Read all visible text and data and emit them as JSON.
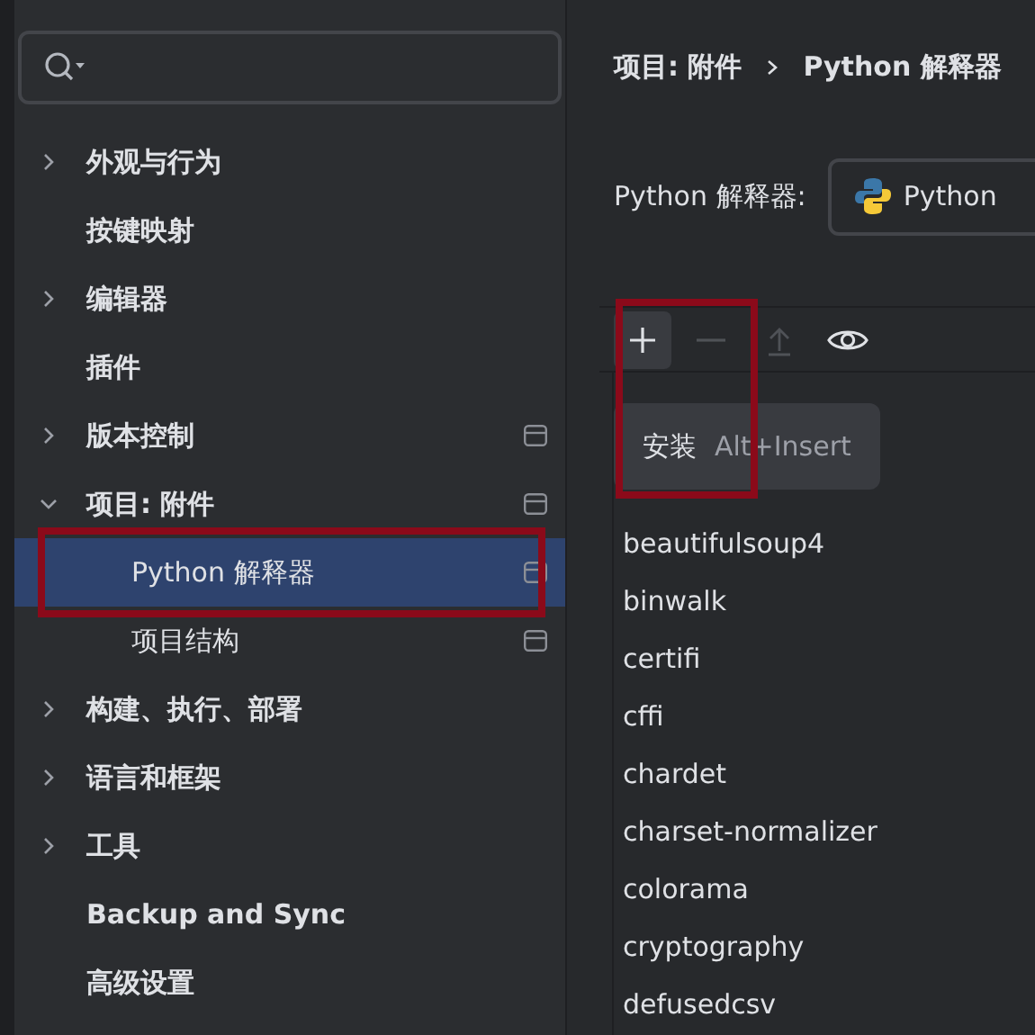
{
  "sidebar": {
    "items": [
      {
        "label": "外观与行为",
        "expanded": false,
        "selected": false,
        "scoped": false
      },
      {
        "label": "按键映射",
        "selected": false,
        "scoped": false
      },
      {
        "label": "编辑器",
        "expanded": false,
        "selected": false,
        "scoped": false
      },
      {
        "label": "插件",
        "selected": false,
        "scoped": false
      },
      {
        "label": "版本控制",
        "expanded": false,
        "selected": false,
        "scoped": true
      },
      {
        "label": "项目: 附件",
        "expanded": true,
        "selected": false,
        "scoped": true,
        "children": [
          {
            "label": "Python 解释器",
            "selected": true,
            "scoped": true
          },
          {
            "label": "项目结构",
            "selected": false,
            "scoped": true
          }
        ]
      },
      {
        "label": "构建、执行、部署",
        "expanded": false,
        "selected": false,
        "scoped": false
      },
      {
        "label": "语言和框架",
        "expanded": false,
        "selected": false,
        "scoped": false
      },
      {
        "label": "工具",
        "expanded": false,
        "selected": false,
        "scoped": false
      },
      {
        "label": "Backup and Sync",
        "selected": false,
        "scoped": false
      },
      {
        "label": "高级设置",
        "selected": false,
        "scoped": false
      }
    ]
  },
  "breadcrumb": [
    "项目: 附件",
    "Python 解释器"
  ],
  "interpreter": {
    "label": "Python 解释器:",
    "value": "Python"
  },
  "toolbar": [
    {
      "kind": "add",
      "disabled": false
    },
    {
      "kind": "remove",
      "disabled": true
    },
    {
      "kind": "upgrade",
      "disabled": true
    },
    {
      "kind": "show",
      "disabled": false
    }
  ],
  "tooltip": {
    "label": "安装",
    "shortcut": "Alt+Insert"
  },
  "packages": [
    "beautifulsoup4",
    "binwalk",
    "certifi",
    "cffi",
    "chardet",
    "charset-normalizer",
    "colorama",
    "cryptography",
    "defusedcsv"
  ]
}
